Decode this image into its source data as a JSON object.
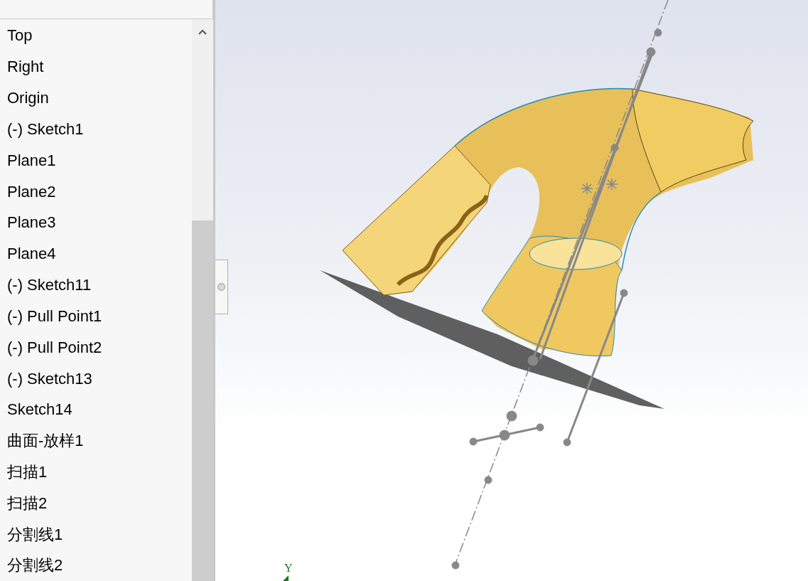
{
  "feature_tree": {
    "items": [
      {
        "label": "Top"
      },
      {
        "label": "Right"
      },
      {
        "label": "Origin"
      },
      {
        "label": "(-) Sketch1"
      },
      {
        "label": "Plane1"
      },
      {
        "label": "Plane2"
      },
      {
        "label": "Plane3"
      },
      {
        "label": "Plane4"
      },
      {
        "label": "(-) Sketch11"
      },
      {
        "label": "(-) Pull Point1"
      },
      {
        "label": "(-) Pull Point2"
      },
      {
        "label": "(-) Sketch13"
      },
      {
        "label": "Sketch14"
      },
      {
        "label": "曲面-放样1"
      },
      {
        "label": "扫描1"
      },
      {
        "label": "扫描2"
      },
      {
        "label": "分割线1"
      },
      {
        "label": "分割线2"
      }
    ]
  },
  "viewport": {
    "axis_label": "Y"
  }
}
